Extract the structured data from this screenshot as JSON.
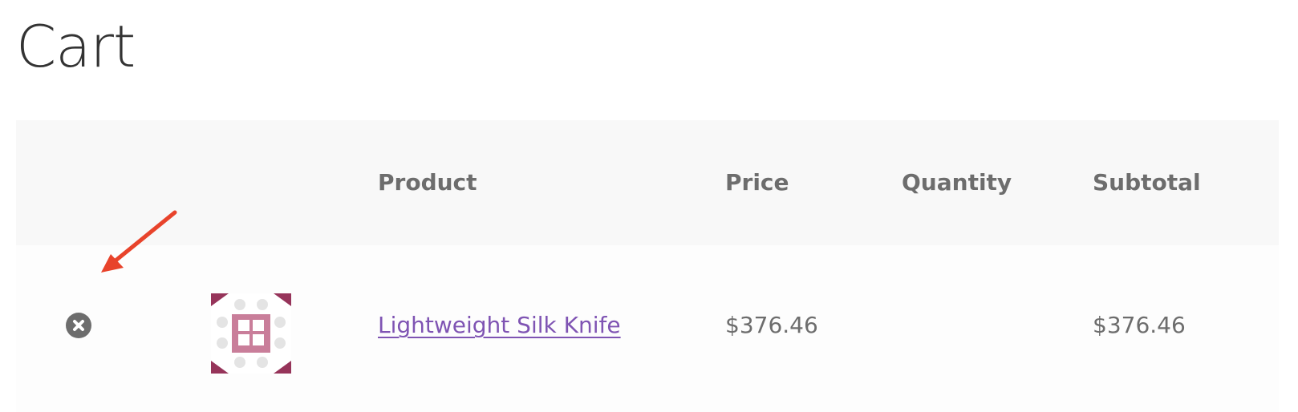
{
  "page": {
    "title": "Cart"
  },
  "table": {
    "headers": {
      "product": "Product",
      "price": "Price",
      "quantity": "Quantity",
      "subtotal": "Subtotal"
    },
    "rows": [
      {
        "product_name": "Lightweight Silk Knife",
        "price": "$376.46",
        "quantity": "",
        "subtotal": "$376.46",
        "remove_icon": "remove-circle-x-icon",
        "thumbnail_icon": "product-placeholder-icon"
      }
    ]
  },
  "colors": {
    "title_text": "#333333",
    "header_text": "#6d6d6d",
    "header_background": "#f8f8f8",
    "row_background": "#fdfdfd",
    "link": "#7f54b3",
    "remove_icon": "#6d6d6d",
    "annotation_arrow": "#e8432b"
  },
  "annotation": {
    "icon": "red-arrow-icon"
  }
}
